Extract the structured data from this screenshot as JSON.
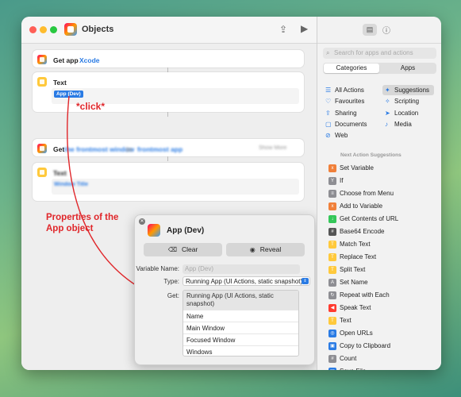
{
  "window": {
    "title": "Objects"
  },
  "actions": {
    "get_app": {
      "label": "Get app",
      "value": "Xcode"
    },
    "text1": {
      "label": "Text",
      "chip": "App (Dev)"
    },
    "get2": {
      "label": "Get",
      "blur1": "the frontmost window",
      "blur2": "in",
      "blur3": "frontmost app",
      "right": "Show More"
    },
    "text2": {
      "label": "Text",
      "blur": "Window Title"
    }
  },
  "annotations": {
    "click": "*click*",
    "properties": "Properties of the App object"
  },
  "popover": {
    "title": "App (Dev)",
    "clear": "Clear",
    "reveal": "Reveal",
    "variable_name_label": "Variable Name:",
    "variable_name_placeholder": "App (Dev)",
    "type_label": "Type:",
    "type_value": "Running App (UI Actions, static snapshot)",
    "get_label": "Get:",
    "get_header": "Running App (UI Actions, static snapshot)",
    "get_items": [
      "Name",
      "Main Window",
      "Focused Window",
      "Windows"
    ]
  },
  "sidebar": {
    "search_placeholder": "Search for apps and actions",
    "tabs": [
      "Categories",
      "Apps"
    ],
    "categories": [
      {
        "label": "All Actions",
        "icon": "list-icon"
      },
      {
        "label": "Suggestions",
        "icon": "sparkle-icon"
      },
      {
        "label": "Favourites",
        "icon": "heart-icon"
      },
      {
        "label": "Scripting",
        "icon": "scripting-icon"
      },
      {
        "label": "Sharing",
        "icon": "share-icon"
      },
      {
        "label": "Location",
        "icon": "location-icon"
      },
      {
        "label": "Documents",
        "icon": "doc-icon"
      },
      {
        "label": "Media",
        "icon": "music-icon"
      },
      {
        "label": "Web",
        "icon": "compass-icon"
      }
    ],
    "suggestions_title": "Next Action Suggestions",
    "suggestions": [
      {
        "label": "Set Variable",
        "color": "#f0803a",
        "icon": "x-icon"
      },
      {
        "label": "If",
        "color": "#8e8e93",
        "icon": "branch-icon"
      },
      {
        "label": "Choose from Menu",
        "color": "#8e8e93",
        "icon": "menu-icon"
      },
      {
        "label": "Add to Variable",
        "color": "#f0803a",
        "icon": "x-icon"
      },
      {
        "label": "Get Contents of URL",
        "color": "#34c759",
        "icon": "download-icon"
      },
      {
        "label": "Base64 Encode",
        "color": "#555555",
        "icon": "encode-icon"
      },
      {
        "label": "Match Text",
        "color": "#ffc93c",
        "icon": "text-icon"
      },
      {
        "label": "Replace Text",
        "color": "#ffc93c",
        "icon": "text-icon"
      },
      {
        "label": "Split Text",
        "color": "#ffc93c",
        "icon": "text-icon"
      },
      {
        "label": "Set Name",
        "color": "#8e8e93",
        "icon": "name-icon"
      },
      {
        "label": "Repeat with Each",
        "color": "#8e8e93",
        "icon": "repeat-icon"
      },
      {
        "label": "Speak Text",
        "color": "#ff3b30",
        "icon": "speaker-icon"
      },
      {
        "label": "Text",
        "color": "#ffc93c",
        "icon": "text-icon"
      },
      {
        "label": "Open URLs",
        "color": "#2a7be4",
        "icon": "compass-icon"
      },
      {
        "label": "Copy to Clipboard",
        "color": "#2a7be4",
        "icon": "clipboard-icon"
      },
      {
        "label": "Count",
        "color": "#8e8e93",
        "icon": "count-icon"
      },
      {
        "label": "Save File",
        "color": "#2a7be4",
        "icon": "file-icon"
      }
    ]
  },
  "colors": {
    "accent": "#2a7be4",
    "annotation": "#e0262a"
  }
}
